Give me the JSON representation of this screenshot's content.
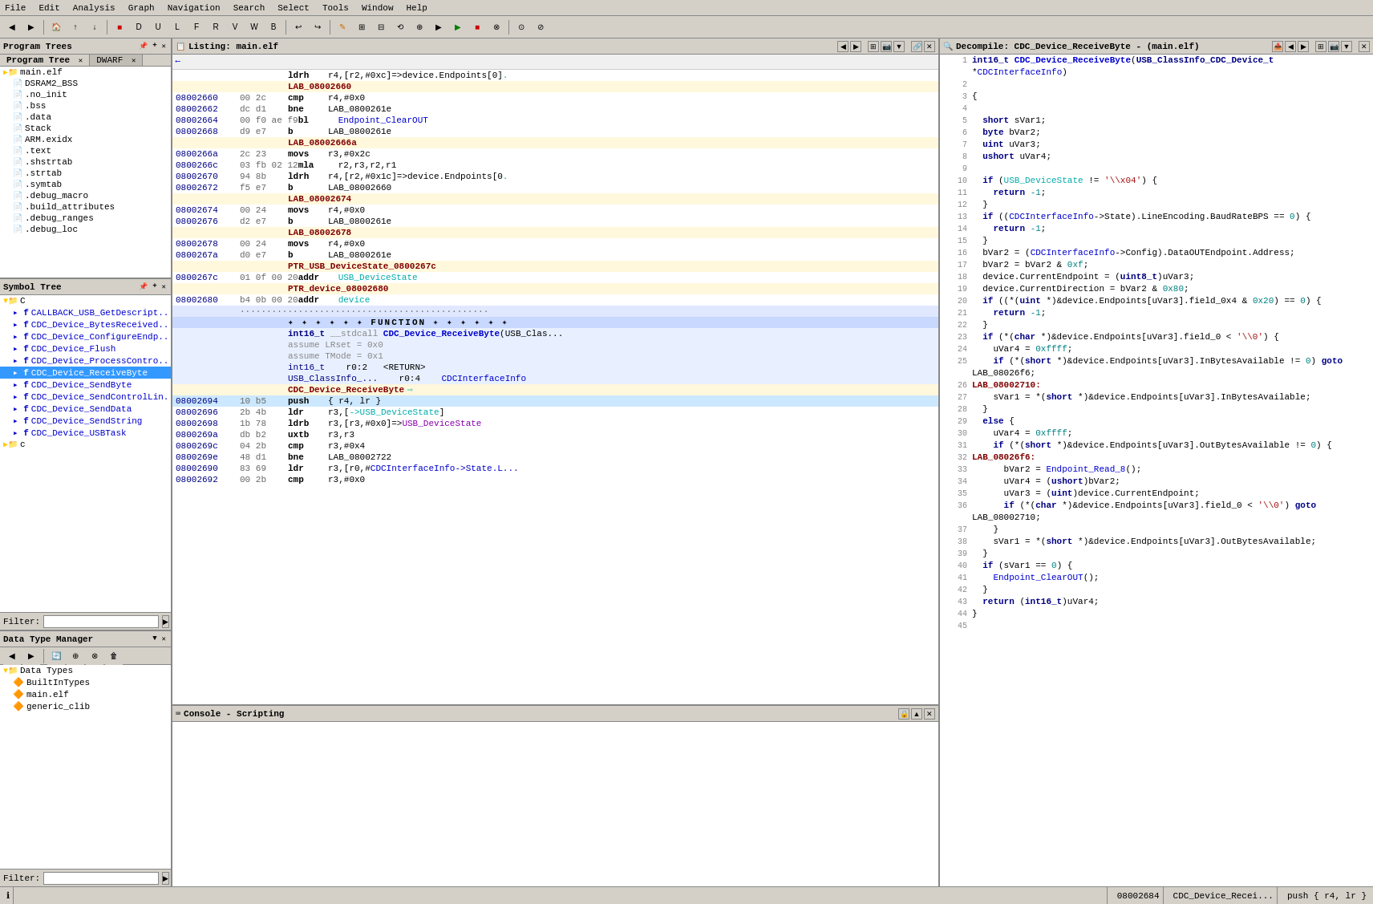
{
  "menu": {
    "items": [
      "File",
      "Edit",
      "Analysis",
      "Graph",
      "Navigation",
      "Search",
      "Select",
      "Tools",
      "Window",
      "Help"
    ]
  },
  "program_trees": {
    "title": "Program Trees",
    "tabs": [
      "Program Tree",
      "DWARF"
    ],
    "items": [
      {
        "label": "main.elf",
        "indent": 0,
        "type": "folder"
      },
      {
        "label": "DSRAM2_BSS",
        "indent": 1,
        "type": "file"
      },
      {
        "label": ".no_init",
        "indent": 1,
        "type": "file"
      },
      {
        "label": ".bss",
        "indent": 1,
        "type": "file"
      },
      {
        "label": ".data",
        "indent": 1,
        "type": "file"
      },
      {
        "label": "Stack",
        "indent": 1,
        "type": "file"
      },
      {
        "label": "ARM.exidx",
        "indent": 1,
        "type": "file"
      },
      {
        "label": ".text",
        "indent": 1,
        "type": "file"
      },
      {
        "label": ".shstrtab",
        "indent": 1,
        "type": "file"
      },
      {
        "label": ".strtab",
        "indent": 1,
        "type": "file"
      },
      {
        "label": ".symtab",
        "indent": 1,
        "type": "file"
      },
      {
        "label": ".debug_macro",
        "indent": 1,
        "type": "file"
      },
      {
        "label": ".build_attributes",
        "indent": 1,
        "type": "file"
      },
      {
        "label": ".debug_ranges",
        "indent": 1,
        "type": "file"
      },
      {
        "label": ".debug_loc",
        "indent": 1,
        "type": "file"
      }
    ]
  },
  "symbol_tree": {
    "title": "Symbol Tree",
    "items": [
      {
        "label": "C",
        "indent": 0,
        "type": "folder"
      },
      {
        "label": "CALLBACK_USB_GetDescript...",
        "indent": 1,
        "type": "func"
      },
      {
        "label": "CDC_Device_BytesReceived...",
        "indent": 1,
        "type": "func"
      },
      {
        "label": "CDC_Device_ConfigureEndp...",
        "indent": 1,
        "type": "func"
      },
      {
        "label": "CDC_Device_Flush",
        "indent": 1,
        "type": "func"
      },
      {
        "label": "CDC_Device_ProcessContro...",
        "indent": 1,
        "type": "func"
      },
      {
        "label": "CDC_Device_ReceiveByte",
        "indent": 1,
        "type": "func",
        "selected": true
      },
      {
        "label": "CDC_Device_SendByte",
        "indent": 1,
        "type": "func"
      },
      {
        "label": "CDC_Device_SendControlLin...",
        "indent": 1,
        "type": "func"
      },
      {
        "label": "CDC_Device_SendData",
        "indent": 1,
        "type": "func"
      },
      {
        "label": "CDC_Device_SendString",
        "indent": 1,
        "type": "func"
      },
      {
        "label": "CDC_Device_USBTask",
        "indent": 1,
        "type": "func"
      },
      {
        "label": "c",
        "indent": 0,
        "type": "folder"
      }
    ],
    "filter_placeholder": ""
  },
  "data_type_manager": {
    "title": "Data Type Manager",
    "items": [
      {
        "label": "Data Types",
        "indent": 0,
        "type": "folder"
      },
      {
        "label": "BuiltInTypes",
        "indent": 1,
        "type": "file"
      },
      {
        "label": "main.elf",
        "indent": 1,
        "type": "file"
      },
      {
        "label": "generic_clib",
        "indent": 1,
        "type": "file"
      }
    ],
    "filter_placeholder": ""
  },
  "listing": {
    "title": "Listing: main.elf",
    "lines": [
      {
        "addr": "",
        "bytes": "",
        "content": "ldrh",
        "operands": "r4,[r2,#0xc]=>device.Endpoints[0].",
        "type": "instr"
      },
      {
        "addr": "",
        "bytes": "",
        "content": "LAB_08002660",
        "operands": "",
        "type": "label"
      },
      {
        "addr": "08002660",
        "bytes": "00 2c",
        "content": "cmp",
        "operands": "r4,#0x0",
        "type": "instr"
      },
      {
        "addr": "08002662",
        "bytes": "dc d1",
        "content": "bne",
        "operands": "LAB_0800261e",
        "type": "instr"
      },
      {
        "addr": "08002664",
        "bytes": "00 f0 ae f9",
        "content": "bl",
        "operands": "Endpoint_ClearOUT",
        "type": "instr"
      },
      {
        "addr": "08002668",
        "bytes": "d9 e7",
        "content": "b",
        "operands": "LAB_0800261e",
        "type": "instr"
      },
      {
        "addr": "",
        "bytes": "",
        "content": "LAB_08002666a",
        "operands": "",
        "type": "label"
      },
      {
        "addr": "0800266a",
        "bytes": "2c 23",
        "content": "movs",
        "operands": "r3,#0x2c",
        "type": "instr"
      },
      {
        "addr": "0800266c",
        "bytes": "03 fb 02 12",
        "content": "mla",
        "operands": "r2,r3,r2,r1",
        "type": "instr"
      },
      {
        "addr": "08002670",
        "bytes": "94 8b",
        "content": "ldrh",
        "operands": "r4,[r2,#0x1c]=>device.Endpoints[0].",
        "type": "instr"
      },
      {
        "addr": "08002672",
        "bytes": "f5 e7",
        "content": "b",
        "operands": "LAB_08002660",
        "type": "instr"
      },
      {
        "addr": "",
        "bytes": "",
        "content": "LAB_08002674",
        "operands": "",
        "type": "label"
      },
      {
        "addr": "08002674",
        "bytes": "00 24",
        "content": "movs",
        "operands": "r4,#0x0",
        "type": "instr"
      },
      {
        "addr": "08002676",
        "bytes": "d2 e7",
        "content": "b",
        "operands": "LAB_0800261e",
        "type": "instr"
      },
      {
        "addr": "",
        "bytes": "",
        "content": "LAB_08002678",
        "operands": "",
        "type": "label"
      },
      {
        "addr": "08002678",
        "bytes": "00 24",
        "content": "movs",
        "operands": "r4,#0x0",
        "type": "instr"
      },
      {
        "addr": "0800267a",
        "bytes": "d0 e7",
        "content": "b",
        "operands": "LAB_0800261e",
        "type": "instr"
      },
      {
        "addr": "",
        "bytes": "",
        "content": "PTR_USB_DeviceState_0800267c",
        "operands": "",
        "type": "ptr-label"
      },
      {
        "addr": "0800267c",
        "bytes": "01 0f 00 20",
        "content": "addr",
        "operands": "USB_DeviceState",
        "type": "instr"
      },
      {
        "addr": "",
        "bytes": "",
        "content": "PTR_device_08002680",
        "operands": "",
        "type": "ptr-label"
      },
      {
        "addr": "08002680",
        "bytes": "b4 0b 00 20",
        "content": "addr",
        "operands": "device",
        "type": "instr"
      },
      {
        "addr": "",
        "bytes": "",
        "content": "FUNCTION",
        "operands": "",
        "type": "section-header"
      },
      {
        "addr": "",
        "bytes": "",
        "content": "int16_t __stdcall CDC_Device_ReceiveByte(USB_Clas...",
        "operands": "",
        "type": "func-sig"
      },
      {
        "addr": "",
        "bytes": "",
        "content": "assume LRset = 0x0",
        "operands": "",
        "type": "assume"
      },
      {
        "addr": "",
        "bytes": "",
        "content": "assume TMode = 0x1",
        "operands": "",
        "type": "assume"
      },
      {
        "addr": "",
        "bytes": "",
        "content": "int16_t    r0:2   <RETURN>",
        "operands": "",
        "type": "param"
      },
      {
        "addr": "",
        "bytes": "",
        "content": "USB_ClassInfo_...    r0:4    CDCInterfaceInfo",
        "operands": "",
        "type": "param"
      },
      {
        "addr": "",
        "bytes": "",
        "content": "CDC_Device_ReceiveByte",
        "operands": "",
        "type": "func-label"
      },
      {
        "addr": "08002694",
        "bytes": "10 b5",
        "content": "push",
        "operands": "{ r4, lr }",
        "type": "instr",
        "highlighted": true
      },
      {
        "addr": "08002696",
        "bytes": "2b 4b",
        "content": "ldr",
        "operands": "r3,[->USB_DeviceState]",
        "type": "instr"
      },
      {
        "addr": "08002698",
        "bytes": "1b 78",
        "content": "ldrb",
        "operands": "r3,[r3,#0x0]=>USB_DeviceState",
        "type": "instr"
      },
      {
        "addr": "0800269a",
        "bytes": "db b2",
        "content": "uxtb",
        "operands": "r3,r3",
        "type": "instr"
      },
      {
        "addr": "0800269c",
        "bytes": "04 2b",
        "content": "cmp",
        "operands": "r3,#0x4",
        "type": "instr"
      },
      {
        "addr": "0800269e",
        "bytes": "48 d1",
        "content": "bne",
        "operands": "LAB_08002722",
        "type": "instr"
      },
      {
        "addr": "08002690",
        "bytes": "83 69",
        "content": "ldr",
        "operands": "r3,[r0,#CDCInterfaceInfo->State.L...",
        "type": "instr"
      },
      {
        "addr": "08002692",
        "bytes": "00 2b",
        "content": "cmp",
        "operands": "r3,#0x0",
        "type": "instr"
      }
    ]
  },
  "decompile": {
    "title": "Decompile: CDC_Device_ReceiveByte - (main.elf)",
    "lines": [
      {
        "num": "1",
        "code": "int16_t CDC_Device_ReceiveByte(USB_ClassInfo_CDC_Device_t *CDCInterfaceInfo)"
      },
      {
        "num": "2",
        "code": ""
      },
      {
        "num": "3",
        "code": "{"
      },
      {
        "num": "4",
        "code": ""
      },
      {
        "num": "5",
        "code": "  short sVar1;"
      },
      {
        "num": "6",
        "code": "  byte bVar2;"
      },
      {
        "num": "7",
        "code": "  uint uVar3;"
      },
      {
        "num": "8",
        "code": "  ushort uVar4;"
      },
      {
        "num": "9",
        "code": ""
      },
      {
        "num": "10",
        "code": "  if (USB_DeviceState != '\\x04') {"
      },
      {
        "num": "11",
        "code": "    return -1;"
      },
      {
        "num": "12",
        "code": "  }"
      },
      {
        "num": "13",
        "code": "  if ((CDCInterfaceInfo->State).LineEncoding.BaudRateBPS == 0) {"
      },
      {
        "num": "14",
        "code": "    return -1;"
      },
      {
        "num": "15",
        "code": "  }"
      },
      {
        "num": "16",
        "code": "  bVar2 = (CDCInterfaceInfo->Config).DataOUTEndpoint.Address;"
      },
      {
        "num": "17",
        "code": "  bVar2 = bVar2 & 0xf;"
      },
      {
        "num": "18",
        "code": "  device.CurrentEndpoint = (uint8_t)uVar3;"
      },
      {
        "num": "19",
        "code": "  device.CurrentDirection = bVar2 & 0x80;"
      },
      {
        "num": "20",
        "code": "  if ((*(uint *)&device.Endpoints[uVar3].field_0x4 & 0x20) == 0) {"
      },
      {
        "num": "21",
        "code": "    return -1;"
      },
      {
        "num": "22",
        "code": "  }"
      },
      {
        "num": "23",
        "code": "  if (*(char *)&device.Endpoints[uVar3].field_0 < '\\0') {"
      },
      {
        "num": "24",
        "code": "    uVar4 = 0xffff;"
      },
      {
        "num": "25",
        "code": "    if (*(short *)&device.Endpoints[uVar3].InBytesAvailable != 0) goto LAB_08026f6;"
      },
      {
        "num": "26",
        "code": "LAB_08002710:"
      },
      {
        "num": "27",
        "code": "    sVar1 = *(short *)&device.Endpoints[uVar3].InBytesAvailable;"
      },
      {
        "num": "28",
        "code": "  }"
      },
      {
        "num": "29",
        "code": "  else {"
      },
      {
        "num": "30",
        "code": "    uVar4 = 0xffff;"
      },
      {
        "num": "31",
        "code": "    if (*(short *)&device.Endpoints[uVar3].OutBytesAvailable != 0) {"
      },
      {
        "num": "32",
        "code": "LAB_08026f6:"
      },
      {
        "num": "33",
        "code": "      bVar2 = Endpoint_Read_8();"
      },
      {
        "num": "34",
        "code": "      uVar4 = (ushort)bVar2;"
      },
      {
        "num": "35",
        "code": "      uVar3 = (uint)device.CurrentEndpoint;"
      },
      {
        "num": "36",
        "code": "      if (*(char *)&device.Endpoints[uVar3].field_0 < '\\0') goto LAB_08002710;"
      },
      {
        "num": "37",
        "code": "    }"
      },
      {
        "num": "38",
        "code": "    sVar1 = *(short *)&device.Endpoints[uVar3].OutBytesAvailable;"
      },
      {
        "num": "39",
        "code": "  }"
      },
      {
        "num": "40",
        "code": "  if (sVar1 == 0) {"
      },
      {
        "num": "41",
        "code": "    Endpoint_ClearOUT();"
      },
      {
        "num": "42",
        "code": "  }"
      },
      {
        "num": "43",
        "code": "  return (int16_t)uVar4;"
      },
      {
        "num": "44",
        "code": "}"
      },
      {
        "num": "45",
        "code": ""
      }
    ]
  },
  "console": {
    "title": "Console - Scripting"
  },
  "statusbar": {
    "addr": "08002684",
    "func_name": "CDC_Device_Recei...",
    "instr": "push { r4, lr }"
  }
}
